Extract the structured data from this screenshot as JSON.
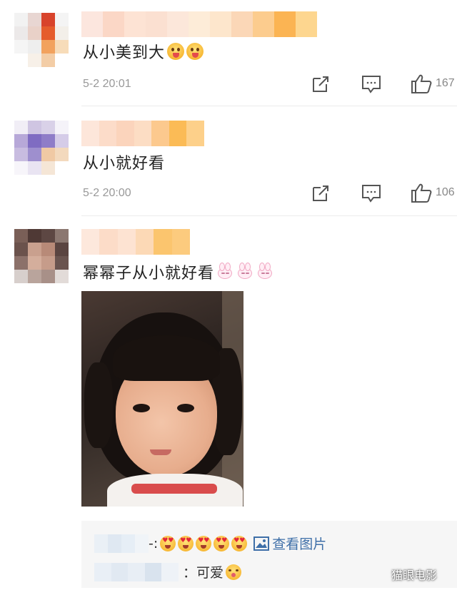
{
  "comments": [
    {
      "text": "从小美到大",
      "emoji": [
        "tongue-face-emoji",
        "tongue-face-emoji"
      ],
      "timestamp": "5-2 20:01",
      "likes": "167"
    },
    {
      "text": "从小就好看",
      "emoji": [],
      "timestamp": "5-2 20:00",
      "likes": "106"
    },
    {
      "text": "幂幂子从小就好看",
      "emoji": [
        "bunny-emoji",
        "bunny-emoji",
        "bunny-emoji"
      ],
      "has_photo": true
    }
  ],
  "replies": [
    {
      "separator": "-:",
      "emoji": [
        "heart-eyes-emoji",
        "heart-eyes-emoji",
        "heart-eyes-emoji",
        "heart-eyes-emoji",
        "heart-eyes-emoji"
      ],
      "view_pic_label": "查看图片"
    },
    {
      "separator": "：可爱",
      "emoji": [
        "kiss-face-emoji"
      ]
    }
  ],
  "icons": {
    "share": "share-icon",
    "comment": "comment-icon",
    "like": "thumbs-up-icon",
    "image": "image-icon"
  },
  "watermark": "猫眼电影",
  "colors": {
    "link": "#3e6fa8",
    "meta": "#999999",
    "reply_bg": "#f6f6f6"
  }
}
